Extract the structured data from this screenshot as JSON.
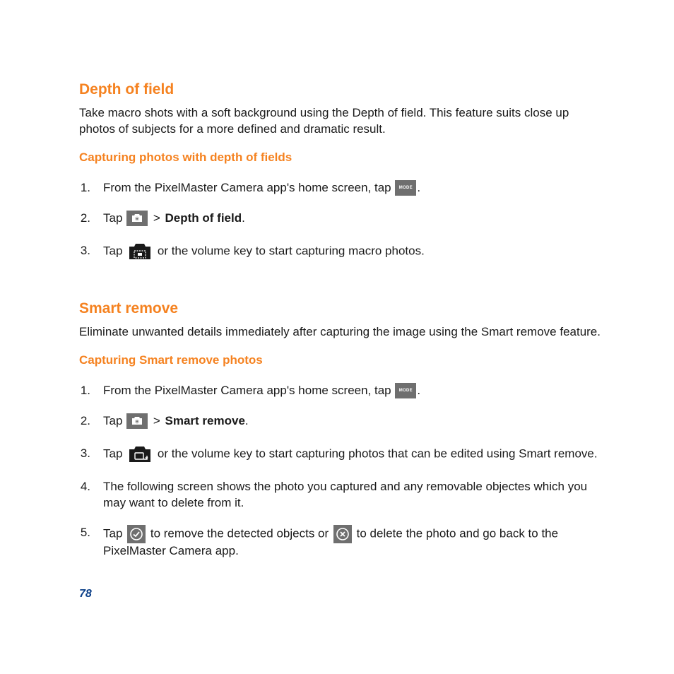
{
  "section1": {
    "heading": "Depth of field",
    "intro": "Take macro shots with a soft background using the Depth of field. This feature suits close up photos of subjects for a more defined and dramatic result.",
    "subheading": "Capturing photos with depth of fields",
    "step1_pre": "From the PixelMaster Camera app's home screen, tap ",
    "step1_post": ".",
    "step2_tap": "Tap ",
    "step2_gt": " > ",
    "step2_bold": "Depth of field",
    "step2_post": ".",
    "step3_tap": "Tap ",
    "step3_post": " or the volume key to start capturing macro photos.",
    "mode_label": "MODE"
  },
  "section2": {
    "heading": "Smart remove",
    "intro": "Eliminate unwanted details immediately after capturing the image using the Smart remove feature.",
    "subheading": "Capturing Smart remove photos",
    "step1_pre": "From the PixelMaster Camera app's home screen, tap ",
    "step1_post": ".",
    "step2_tap": "Tap ",
    "step2_gt": " > ",
    "step2_bold": "Smart remove",
    "step2_post": ".",
    "step3_tap": "Tap ",
    "step3_post": " or the volume key to start capturing photos that can be edited using Smart remove.",
    "step4": "The following screen shows the photo you captured and any removable objectes which you may want to delete from it.",
    "step5_tap": "Tap ",
    "step5_mid": " to remove the detected objects or ",
    "step5_post": " to delete the photo and go back to the PixelMaster Camera app.",
    "mode_label": "MODE"
  },
  "nums": {
    "n1": "1.",
    "n2": "2.",
    "n3": "3.",
    "n4": "4.",
    "n5": "5."
  },
  "page_number": "78"
}
